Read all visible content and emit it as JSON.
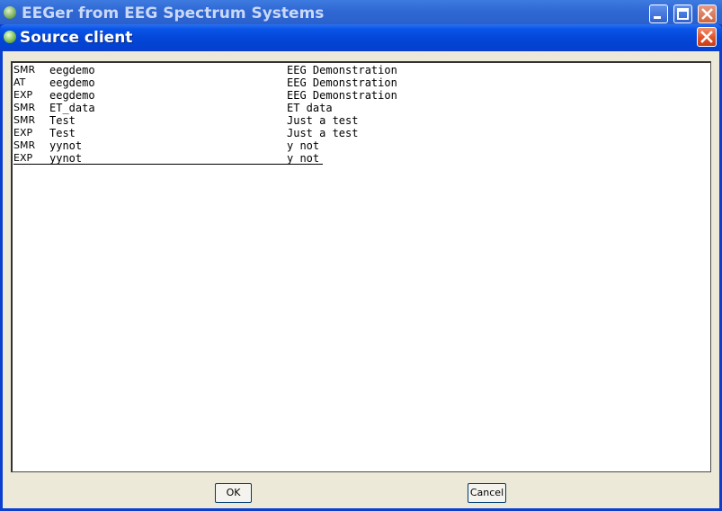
{
  "background_window": {
    "title": "EEGer from EEG Spectrum Systems",
    "icon": "eeger-app-icon"
  },
  "dialog": {
    "title": "Source client",
    "icon": "eeger-app-icon",
    "close_icon": "close-icon"
  },
  "list": {
    "rows": [
      {
        "type": "SMR",
        "name": "eegdemo",
        "description": "EEG Demonstration"
      },
      {
        "type": "AT",
        "name": "eegdemo",
        "description": "EEG Demonstration"
      },
      {
        "type": "EXP",
        "name": "eegdemo",
        "description": "EEG Demonstration"
      },
      {
        "type": "SMR",
        "name": "ET_data",
        "description": "ET data"
      },
      {
        "type": "SMR",
        "name": "Test",
        "description": "Just a test"
      },
      {
        "type": "EXP",
        "name": "Test",
        "description": "Just a test"
      },
      {
        "type": "SMR",
        "name": "yynot",
        "description": "y not"
      },
      {
        "type": "EXP",
        "name": "yynot",
        "description": "y not"
      }
    ],
    "selected_index": 7
  },
  "buttons": {
    "ok": "OK",
    "cancel": "Cancel"
  },
  "colors": {
    "title_bar": "#0447d8",
    "dialog_face": "#ece9d8",
    "close_button": "#e0522a"
  }
}
